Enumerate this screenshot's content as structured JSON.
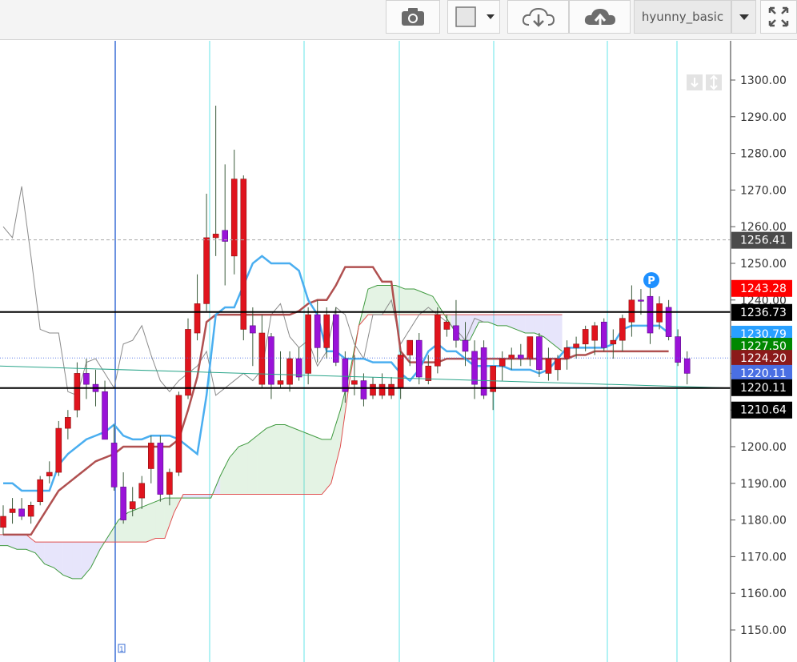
{
  "toolbar": {
    "snapshot_icon": "camera-icon",
    "color_box_icon": "color-swatch-icon",
    "dropdown_icon": "chevron-down-icon",
    "save_cloud_icon": "cloud-download-icon",
    "load_cloud_icon": "cloud-upload-icon",
    "layout_name": "hyunny_basic",
    "fullscreen_icon": "fullscreen-icon"
  },
  "chart_data": {
    "type": "candlestick",
    "title": "",
    "ylim": [
      1145,
      1305
    ],
    "y_ticks": [
      "1300.00",
      "1290.00",
      "1280.00",
      "1270.00",
      "1260.00",
      "1250.00",
      "1240.00",
      "1230.00",
      "1220.00",
      "1210.00",
      "1200.00",
      "1190.00",
      "1180.00",
      "1170.00",
      "1160.00",
      "1150.00"
    ],
    "current_price_line": 1256.41,
    "price_tags": [
      {
        "label": "1256.41",
        "value": 1256.41,
        "bg": "#4a4a4a",
        "fg": "#ffffff"
      },
      {
        "label": "1243.28",
        "value": 1243.28,
        "bg": "#ff0000",
        "fg": "#ffffff"
      },
      {
        "label": "1236.73",
        "value": 1236.73,
        "bg": "#000000",
        "fg": "#ffffff"
      },
      {
        "label": "1230.79",
        "value": 1230.79,
        "bg": "#29a0ff",
        "fg": "#ffffff"
      },
      {
        "label": "1227.50",
        "value": 1227.5,
        "bg": "#008800",
        "fg": "#ffffff"
      },
      {
        "label": "1224.20",
        "value": 1224.2,
        "bg": "#8b1a1a",
        "fg": "#ffffff"
      },
      {
        "label": "1220.11",
        "value": 1220.11,
        "bg": "#4a6fe3",
        "fg": "#ffffff"
      },
      {
        "label": "1220.11",
        "value": 1220.11,
        "bg": "#000000",
        "fg": "#ffffff"
      },
      {
        "label": "1210.64",
        "value": 1210.64,
        "bg": "#000000",
        "fg": "#ffffff"
      }
    ],
    "horizontal_lines": [
      1236.73,
      1216.0
    ],
    "candles": [
      {
        "o": 1181,
        "h": 1184,
        "l": 1176,
        "c": 1178,
        "bull": true
      },
      {
        "o": 1182,
        "h": 1186,
        "l": 1179,
        "c": 1183,
        "bull": true
      },
      {
        "o": 1183,
        "h": 1186,
        "l": 1180,
        "c": 1181,
        "bull": false
      },
      {
        "o": 1181,
        "h": 1185,
        "l": 1179,
        "c": 1184,
        "bull": true
      },
      {
        "o": 1185,
        "h": 1192,
        "l": 1184,
        "c": 1191,
        "bull": true
      },
      {
        "o": 1192,
        "h": 1196,
        "l": 1190,
        "c": 1193,
        "bull": true
      },
      {
        "o": 1193,
        "h": 1207,
        "l": 1192,
        "c": 1205,
        "bull": true
      },
      {
        "o": 1205,
        "h": 1210,
        "l": 1202,
        "c": 1208,
        "bull": true
      },
      {
        "o": 1210,
        "h": 1223,
        "l": 1208,
        "c": 1220,
        "bull": true
      },
      {
        "o": 1220,
        "h": 1224,
        "l": 1213,
        "c": 1217,
        "bull": false
      },
      {
        "o": 1217,
        "h": 1221,
        "l": 1211,
        "c": 1215,
        "bull": false
      },
      {
        "o": 1215,
        "h": 1218,
        "l": 1204,
        "c": 1202,
        "bull": false
      },
      {
        "o": 1201,
        "h": 1206,
        "l": 1188,
        "c": 1189,
        "bull": false
      },
      {
        "o": 1189,
        "h": 1193,
        "l": 1179,
        "c": 1180,
        "bull": false
      },
      {
        "o": 1183,
        "h": 1189,
        "l": 1181,
        "c": 1185,
        "bull": true
      },
      {
        "o": 1186,
        "h": 1192,
        "l": 1183,
        "c": 1190,
        "bull": true
      },
      {
        "o": 1194,
        "h": 1203,
        "l": 1190,
        "c": 1201,
        "bull": true
      },
      {
        "o": 1201,
        "h": 1203,
        "l": 1185,
        "c": 1187,
        "bull": false
      },
      {
        "o": 1187,
        "h": 1194,
        "l": 1184,
        "c": 1193,
        "bull": true
      },
      {
        "o": 1193,
        "h": 1215,
        "l": 1192,
        "c": 1214,
        "bull": true
      },
      {
        "o": 1214,
        "h": 1235,
        "l": 1213,
        "c": 1232,
        "bull": true
      },
      {
        "o": 1231,
        "h": 1247,
        "l": 1229,
        "c": 1239,
        "bull": true
      },
      {
        "o": 1239,
        "h": 1269,
        "l": 1237,
        "c": 1257,
        "bull": true
      },
      {
        "o": 1257,
        "h": 1293,
        "l": 1252,
        "c": 1258,
        "bull": true
      },
      {
        "o": 1259,
        "h": 1277,
        "l": 1244,
        "c": 1256,
        "bull": false
      },
      {
        "o": 1252,
        "h": 1281,
        "l": 1247,
        "c": 1273,
        "bull": true
      },
      {
        "o": 1273,
        "h": 1274,
        "l": 1229,
        "c": 1232,
        "bull": true
      },
      {
        "o": 1233,
        "h": 1238,
        "l": 1222,
        "c": 1231,
        "bull": false
      },
      {
        "o": 1231,
        "h": 1236,
        "l": 1216,
        "c": 1217,
        "bull": true
      },
      {
        "o": 1217,
        "h": 1231,
        "l": 1213,
        "c": 1230,
        "bull": false
      },
      {
        "o": 1218,
        "h": 1226,
        "l": 1216,
        "c": 1217,
        "bull": true
      },
      {
        "o": 1217,
        "h": 1226,
        "l": 1215,
        "c": 1224,
        "bull": true
      },
      {
        "o": 1224,
        "h": 1227,
        "l": 1218,
        "c": 1219,
        "bull": false
      },
      {
        "o": 1220,
        "h": 1238,
        "l": 1217,
        "c": 1236,
        "bull": true
      },
      {
        "o": 1236,
        "h": 1240,
        "l": 1223,
        "c": 1227,
        "bull": false
      },
      {
        "o": 1227,
        "h": 1238,
        "l": 1224,
        "c": 1236,
        "bull": true
      },
      {
        "o": 1236,
        "h": 1238,
        "l": 1222,
        "c": 1223,
        "bull": false
      },
      {
        "o": 1224,
        "h": 1226,
        "l": 1212,
        "c": 1215,
        "bull": false
      },
      {
        "o": 1217,
        "h": 1225,
        "l": 1214,
        "c": 1218,
        "bull": true
      },
      {
        "o": 1218,
        "h": 1220,
        "l": 1211,
        "c": 1213,
        "bull": false
      },
      {
        "o": 1214,
        "h": 1219,
        "l": 1213,
        "c": 1217,
        "bull": true
      },
      {
        "o": 1214,
        "h": 1220,
        "l": 1213,
        "c": 1217,
        "bull": true
      },
      {
        "o": 1214,
        "h": 1219,
        "l": 1213,
        "c": 1217,
        "bull": true
      },
      {
        "o": 1216,
        "h": 1226,
        "l": 1213,
        "c": 1225,
        "bull": true
      },
      {
        "o": 1225,
        "h": 1229,
        "l": 1222,
        "c": 1229,
        "bull": true
      },
      {
        "o": 1229,
        "h": 1231,
        "l": 1217,
        "c": 1219,
        "bull": false
      },
      {
        "o": 1218,
        "h": 1225,
        "l": 1217,
        "c": 1222,
        "bull": true
      },
      {
        "o": 1222,
        "h": 1238,
        "l": 1220,
        "c": 1236,
        "bull": true
      },
      {
        "o": 1234,
        "h": 1236,
        "l": 1230,
        "c": 1232,
        "bull": true
      },
      {
        "o": 1233,
        "h": 1240,
        "l": 1227,
        "c": 1229,
        "bull": false
      },
      {
        "o": 1229,
        "h": 1234,
        "l": 1222,
        "c": 1226,
        "bull": false
      },
      {
        "o": 1226,
        "h": 1229,
        "l": 1213,
        "c": 1217,
        "bull": false
      },
      {
        "o": 1227,
        "h": 1229,
        "l": 1213,
        "c": 1214,
        "bull": false
      },
      {
        "o": 1215,
        "h": 1222,
        "l": 1210,
        "c": 1222,
        "bull": true
      },
      {
        "o": 1222,
        "h": 1226,
        "l": 1218,
        "c": 1224,
        "bull": true
      },
      {
        "o": 1224,
        "h": 1227,
        "l": 1221,
        "c": 1225,
        "bull": true
      },
      {
        "o": 1225,
        "h": 1228,
        "l": 1222,
        "c": 1224,
        "bull": false
      },
      {
        "o": 1224,
        "h": 1230,
        "l": 1222,
        "c": 1230,
        "bull": true
      },
      {
        "o": 1230,
        "h": 1231,
        "l": 1219,
        "c": 1221,
        "bull": false
      },
      {
        "o": 1220,
        "h": 1227,
        "l": 1218,
        "c": 1224,
        "bull": true
      },
      {
        "o": 1221,
        "h": 1225,
        "l": 1218,
        "c": 1224,
        "bull": true
      },
      {
        "o": 1224,
        "h": 1229,
        "l": 1221,
        "c": 1227,
        "bull": true
      },
      {
        "o": 1227,
        "h": 1230,
        "l": 1224,
        "c": 1228,
        "bull": true
      },
      {
        "o": 1228,
        "h": 1233,
        "l": 1226,
        "c": 1232,
        "bull": true
      },
      {
        "o": 1229,
        "h": 1234,
        "l": 1225,
        "c": 1233,
        "bull": true
      },
      {
        "o": 1234,
        "h": 1235,
        "l": 1226,
        "c": 1227,
        "bull": false
      },
      {
        "o": 1228,
        "h": 1232,
        "l": 1224,
        "c": 1229,
        "bull": true
      },
      {
        "o": 1229,
        "h": 1236,
        "l": 1226,
        "c": 1235,
        "bull": true
      },
      {
        "o": 1240,
        "h": 1244,
        "l": 1230,
        "c": 1234,
        "bull": true
      },
      {
        "o": 1240,
        "h": 1243,
        "l": 1236,
        "c": 1240,
        "bull": false
      },
      {
        "o": 1241,
        "h": 1244,
        "l": 1228,
        "c": 1231,
        "bull": false
      },
      {
        "o": 1239,
        "h": 1241,
        "l": 1232,
        "c": 1234,
        "bull": true
      },
      {
        "o": 1238,
        "h": 1240,
        "l": 1229,
        "c": 1230,
        "bull": false
      },
      {
        "o": 1230,
        "h": 1232,
        "l": 1222,
        "c": 1223,
        "bull": false
      },
      {
        "o": 1224,
        "h": 1226,
        "l": 1217,
        "c": 1220,
        "bull": false
      }
    ],
    "tenkan": [
      1190,
      1190,
      1188,
      1188,
      1188,
      1188,
      1195,
      1198,
      1200,
      1202,
      1203,
      1204,
      1206,
      1203,
      1202,
      1202,
      1203,
      1203,
      1203,
      1202,
      1200,
      1198,
      1214,
      1236,
      1238,
      1238,
      1244,
      1250,
      1252,
      1250,
      1250,
      1250,
      1248,
      1240,
      1236,
      1226,
      1226,
      1224,
      1224,
      1224,
      1223,
      1223,
      1223,
      1220,
      1218,
      1221,
      1226,
      1228,
      1226,
      1226,
      1224,
      1222,
      1222,
      1222,
      1222,
      1221,
      1221,
      1221,
      1220,
      1221,
      1224,
      1227,
      1227,
      1227,
      1227,
      1227,
      1228,
      1232,
      1233,
      1233,
      1233,
      1233,
      1231
    ],
    "kijun": [
      1176,
      1176,
      1176,
      1176,
      1180,
      1184,
      1188,
      1190,
      1192,
      1194,
      1196,
      1197,
      1198,
      1200,
      1200,
      1200,
      1200,
      1200,
      1200,
      1202,
      1210,
      1219,
      1234,
      1236,
      1236,
      1236,
      1236,
      1236,
      1236,
      1236,
      1236,
      1236,
      1237,
      1239,
      1240,
      1240,
      1244,
      1249,
      1249,
      1249,
      1249,
      1245,
      1245,
      1226,
      1223,
      1223,
      1223,
      1223,
      1224,
      1224,
      1224,
      1224,
      1224,
      1224,
      1224,
      1224,
      1224,
      1224,
      1224,
      1224,
      1224,
      1224,
      1225,
      1225,
      1226,
      1226,
      1226,
      1226,
      1226,
      1226,
      1226,
      1226,
      1226
    ],
    "chikou": [
      1260,
      1257,
      1271,
      1252,
      1232,
      1231,
      1231,
      1215,
      1214,
      1223,
      1224,
      1220,
      1216,
      1228,
      1229,
      1233,
      1225,
      1218,
      1215,
      1218,
      1220,
      1222,
      1226,
      1214,
      1216,
      1218,
      1220,
      1218,
      1221,
      1236,
      1239,
      1230,
      1227,
      1229,
      1222,
      1226,
      1238,
      1236,
      1228,
      1224,
      1236,
      1236,
      1240,
      1228,
      1232,
      1236,
      1238,
      1236,
      1234,
      1232,
      1229,
      1235,
      1234
    ],
    "span_a": [
      1173,
      1173,
      1172,
      1172,
      1171,
      1168,
      1167,
      1165,
      1164,
      1164,
      1167,
      1172,
      1176,
      1180,
      1182,
      1183,
      1184,
      1185,
      1186,
      1186,
      1186,
      1186,
      1186,
      1186,
      1192,
      1197,
      1200,
      1201,
      1203,
      1205,
      1206,
      1206,
      1205,
      1204,
      1203,
      1202,
      1202,
      1210,
      1220,
      1233,
      1243,
      1244,
      1244,
      1244,
      1243,
      1243,
      1242,
      1241,
      1237,
      1233,
      1229,
      1229,
      1234,
      1234,
      1233,
      1233,
      1232,
      1231,
      1231,
      1230,
      1228,
      1226
    ],
    "span_b": [
      1176,
      1176,
      1176,
      1176,
      1174,
      1174,
      1174,
      1174,
      1174,
      1174,
      1174,
      1174,
      1174,
      1174,
      1174,
      1174,
      1174,
      1175,
      1175,
      1182,
      1187,
      1187,
      1187,
      1187,
      1187,
      1187,
      1187,
      1187,
      1187,
      1187,
      1187,
      1187,
      1187,
      1187,
      1187,
      1187,
      1190,
      1200,
      1218,
      1233,
      1236,
      1236,
      1236,
      1236,
      1236,
      1236,
      1236,
      1236,
      1236,
      1236,
      1236,
      1236,
      1236,
      1236,
      1236,
      1236,
      1236,
      1236,
      1236,
      1236,
      1236,
      1236
    ],
    "trend_line": {
      "start": 1222,
      "end": 1216
    },
    "event_marker_label": "P",
    "bottom_marker_label": "1"
  }
}
